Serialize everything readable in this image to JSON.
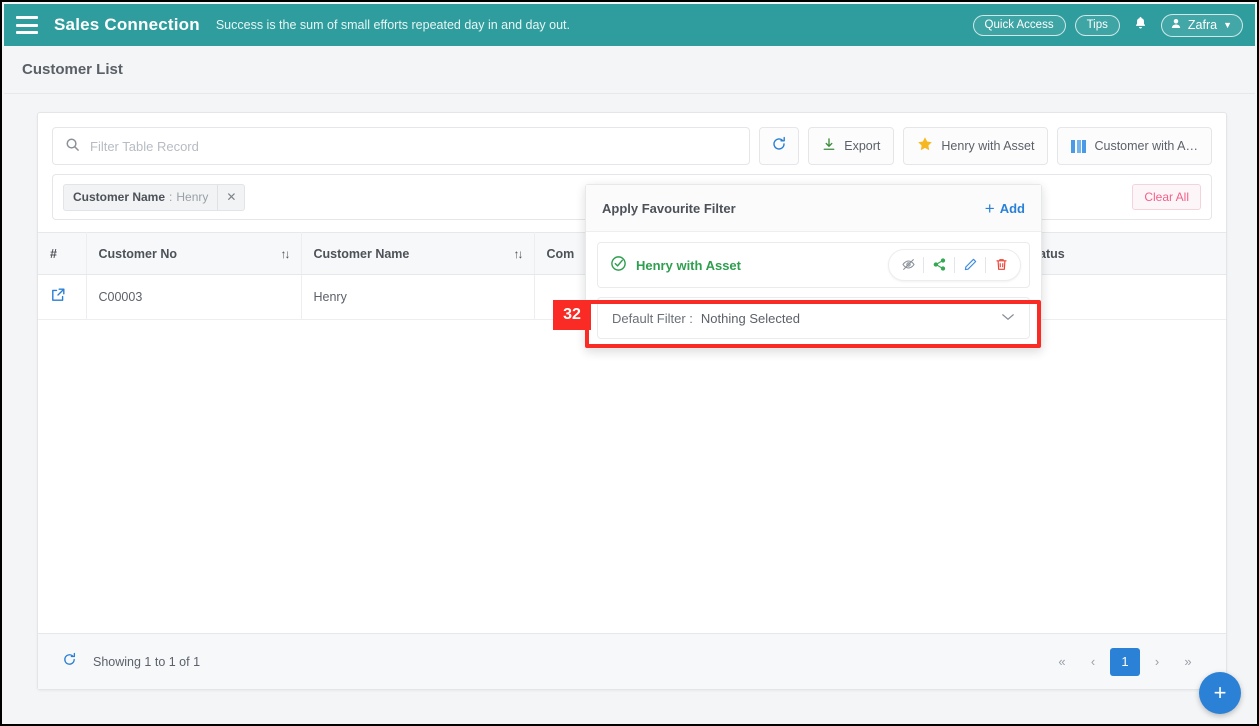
{
  "topbar": {
    "menu_icon": "hamburger-icon",
    "brand": "Sales Connection",
    "tagline": "Success is the sum of small efforts repeated day in and day out.",
    "quick_access": "Quick Access",
    "tips": "Tips",
    "bell_icon": "bell-icon",
    "user_name": "Zafra",
    "user_icon": "user-icon",
    "caret": "⌄",
    "bg_color": "#2f9d9d"
  },
  "page": {
    "title": "Customer List"
  },
  "toolbar": {
    "search_placeholder": "Filter Table Record",
    "search_value": "",
    "search_icon": "search-icon",
    "refresh_icon": "↻",
    "export_label": "Export",
    "export_icon": "download-icon",
    "favourite_label": "Henry with Asset",
    "favourite_icon": "star-icon",
    "columns_label": "Customer with A…",
    "columns_icon": "columns-icon"
  },
  "filters": {
    "chips": [
      {
        "key": "Customer Name",
        "separator": ":",
        "value": "Henry",
        "remove_icon": "✕"
      }
    ],
    "clear_all": "Clear All"
  },
  "table": {
    "columns": [
      {
        "label": "#",
        "sortable": false
      },
      {
        "label": "Customer No",
        "sortable": true
      },
      {
        "label": "Customer Name",
        "sortable": true
      },
      {
        "label": "Com",
        "sortable": false
      },
      {
        "label": "Status",
        "sortable": false
      }
    ],
    "sort_icon": "↑↓",
    "rows": [
      {
        "open_icon": "⧉",
        "customer_no": "C00003",
        "customer_name": "Henry",
        "company": "",
        "status": ""
      }
    ]
  },
  "footer": {
    "refresh_icon": "↻",
    "showing": "Showing 1 to 1 of 1",
    "pager": {
      "first": "«",
      "prev": "‹",
      "pages": [
        "1"
      ],
      "active_page": "1",
      "next": "›",
      "last": "»"
    }
  },
  "favourite_popup": {
    "title": "Apply Favourite Filter",
    "add_label": "Add",
    "add_icon": "+",
    "item": {
      "check_icon": "✔",
      "name": "Henry with Asset",
      "actions": [
        {
          "name": "hide-icon",
          "glyph": "◯"
        },
        {
          "name": "share-icon",
          "glyph": "↱"
        },
        {
          "name": "edit-icon",
          "glyph": "✎"
        },
        {
          "name": "delete-icon",
          "glyph": "Ὕ1"
        }
      ]
    },
    "default_filter": {
      "label": "Default Filter :",
      "value": "Nothing Selected",
      "caret_icon": "chevron-down-icon"
    }
  },
  "annotation": {
    "badge": "32",
    "color": "#fa2a24"
  },
  "fab": {
    "icon": "+",
    "color": "#2a81d6"
  }
}
